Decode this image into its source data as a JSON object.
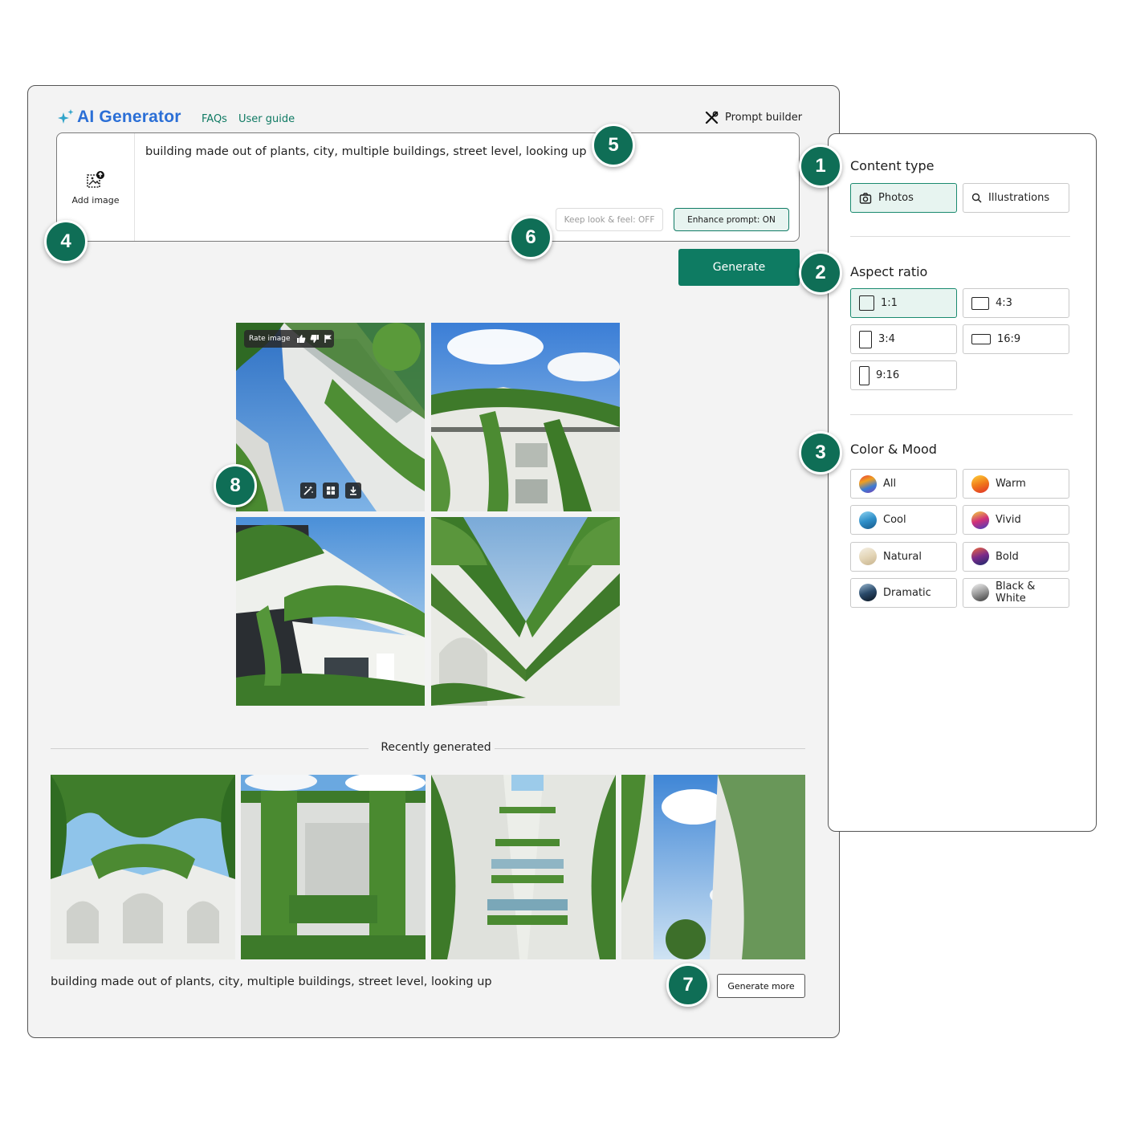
{
  "app": {
    "title": "AI Generator",
    "links": [
      "FAQs",
      "User guide"
    ],
    "prompt_builder": "Prompt builder"
  },
  "prompt": {
    "add_image": "Add image",
    "text": "building made out of plants, city, multiple buildings, street level, looking up",
    "keep_look": "Keep look & feel: OFF",
    "enhance": "Enhance prompt: ON"
  },
  "generate": "Generate",
  "image_overlay": {
    "rate": "Rate image",
    "rate_icons": [
      "thumbs-up-icon",
      "thumbs-down-icon",
      "flag-icon"
    ],
    "actions": [
      "magic-wand-icon",
      "grid-icon",
      "download-icon"
    ]
  },
  "recent": {
    "title": "Recently generated",
    "prompt": "building made out of plants, city, multiple buildings, street level, looking up",
    "more": "Generate more"
  },
  "panel": {
    "content_type": {
      "title": "Content type",
      "options": [
        {
          "label": "Photos",
          "icon": "camera-icon",
          "selected": true
        },
        {
          "label": "Illustrations",
          "icon": "search-icon",
          "selected": false
        }
      ]
    },
    "aspect_ratio": {
      "title": "Aspect ratio",
      "options": [
        {
          "label": "1:1",
          "selected": true
        },
        {
          "label": "4:3",
          "selected": false
        },
        {
          "label": "3:4",
          "selected": false
        },
        {
          "label": "16:9",
          "selected": false
        },
        {
          "label": "9:16",
          "selected": false
        }
      ]
    },
    "color_mood": {
      "title": "Color & Mood",
      "options": [
        {
          "label": "All",
          "colors": [
            "#e63b3b",
            "#f0a020",
            "#3a7bd5",
            "#7b3fb0"
          ]
        },
        {
          "label": "Warm",
          "colors": [
            "#ffd23a",
            "#f07a1a",
            "#e0302a"
          ]
        },
        {
          "label": "Cool",
          "colors": [
            "#8fd3f0",
            "#2f8fc9",
            "#175a8a"
          ]
        },
        {
          "label": "Vivid",
          "colors": [
            "#f3d23a",
            "#d0307a",
            "#3f3fc0"
          ]
        },
        {
          "label": "Natural",
          "colors": [
            "#f4efe4",
            "#e4d6b8",
            "#c8b48e"
          ]
        },
        {
          "label": "Bold",
          "colors": [
            "#f06a3a",
            "#7a2a8a",
            "#1a2a6a"
          ]
        },
        {
          "label": "Dramatic",
          "colors": [
            "#9ab8d0",
            "#2a4a6a",
            "#0a1420"
          ]
        },
        {
          "label": "Black & White",
          "colors": [
            "#f4f4f4",
            "#9a9a9a",
            "#3a3a3a"
          ]
        }
      ]
    }
  },
  "callouts": [
    "1",
    "2",
    "3",
    "4",
    "5",
    "6",
    "7",
    "8"
  ]
}
